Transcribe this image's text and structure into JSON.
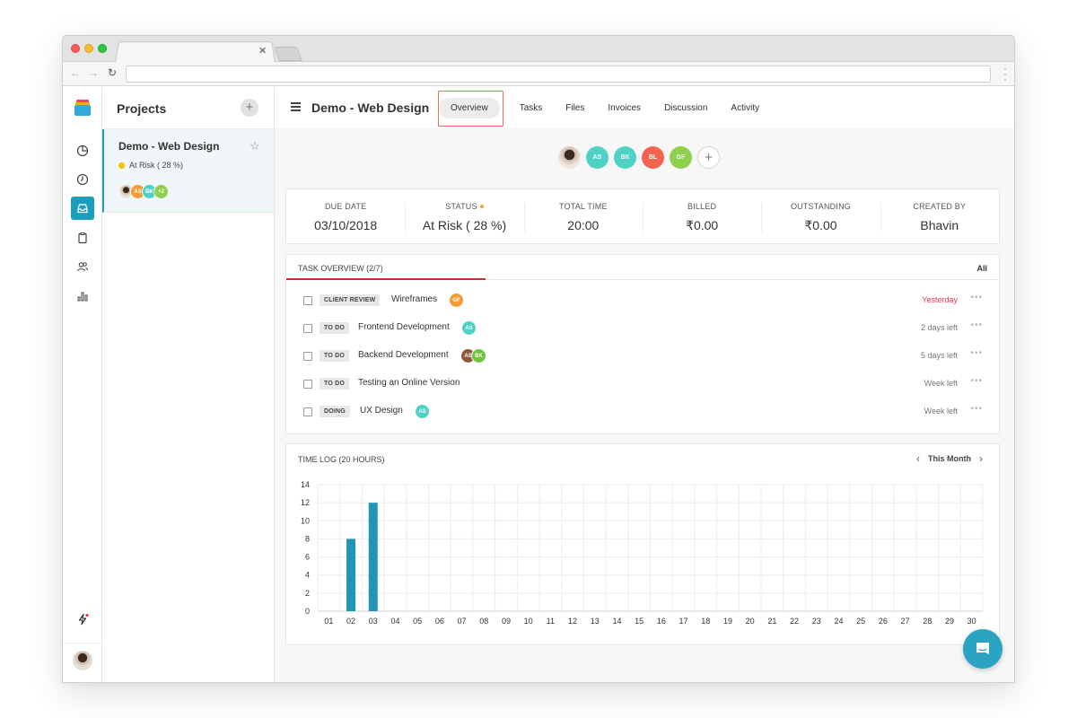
{
  "app": {
    "projects_title": "Projects",
    "project": {
      "name": "Demo - Web Design",
      "status": "At Risk ( 28 %)",
      "avatars": [
        {
          "label": "",
          "photo": true
        },
        {
          "label": "AS",
          "color": "#f39c33"
        },
        {
          "label": "BK",
          "color": "#4fd1c5"
        },
        {
          "label": "+2",
          "color": "#8fd14f"
        }
      ]
    },
    "rail_icons": [
      "logo-icon",
      "pie-chart-icon",
      "clock-icon",
      "inbox-icon",
      "clipboard-icon",
      "users-icon",
      "bar-chart-icon",
      "lightning-icon"
    ]
  },
  "header": {
    "title": "Demo - Web Design",
    "tabs": [
      "Overview",
      "Tasks",
      "Files",
      "Invoices",
      "Discussion",
      "Activity"
    ],
    "active_tab": "Overview"
  },
  "members": [
    {
      "label": "",
      "photo": true
    },
    {
      "label": "AS",
      "color": "#4fd1c5"
    },
    {
      "label": "BK",
      "color": "#4fd1c5"
    },
    {
      "label": "BL",
      "color": "#f2644e"
    },
    {
      "label": "GF",
      "color": "#8fd14f"
    }
  ],
  "stats": [
    {
      "label": "DUE DATE",
      "value": "03/10/2018"
    },
    {
      "label": "STATUS",
      "value": "At Risk ( 28 %)",
      "indicator": "#f5a623"
    },
    {
      "label": "TOTAL TIME",
      "value": "20:00"
    },
    {
      "label": "BILLED",
      "value": "₹0.00"
    },
    {
      "label": "OUTSTANDING",
      "value": "₹0.00"
    },
    {
      "label": "CREATED BY",
      "value": "Bhavin"
    }
  ],
  "task_overview": {
    "title": "TASK OVERVIEW (2/7)",
    "filter": "All",
    "tasks": [
      {
        "tag": "CLIENT REVIEW",
        "name": "Wireframes",
        "assignees": [
          {
            "label": "GF",
            "color": "#f39c33"
          }
        ],
        "due": "Yesterday",
        "overdue": true
      },
      {
        "tag": "TO DO",
        "name": "Frontend Development",
        "assignees": [
          {
            "label": "AS",
            "color": "#4fd1c5"
          }
        ],
        "due": "2 days left",
        "overdue": false
      },
      {
        "tag": "TO DO",
        "name": "Backend Development",
        "assignees": [
          {
            "label": "AS",
            "color": "#8b5a3c"
          },
          {
            "label": "BK",
            "color": "#6fc43a"
          }
        ],
        "due": "5 days left",
        "overdue": false
      },
      {
        "tag": "TO DO",
        "name": "Testing an Online Version",
        "assignees": [],
        "due": "Week left",
        "overdue": false
      },
      {
        "tag": "DOING",
        "name": "UX Design",
        "assignees": [
          {
            "label": "AS",
            "color": "#4fd1c5"
          }
        ],
        "due": "Week left",
        "overdue": false
      }
    ]
  },
  "time_log": {
    "title": "TIME LOG (20 HOURS)",
    "period": "This Month"
  },
  "chart_data": {
    "type": "bar",
    "categories": [
      "01",
      "02",
      "03",
      "04",
      "05",
      "06",
      "07",
      "08",
      "09",
      "10",
      "11",
      "12",
      "13",
      "14",
      "15",
      "16",
      "17",
      "18",
      "19",
      "20",
      "21",
      "22",
      "23",
      "24",
      "25",
      "26",
      "27",
      "28",
      "29",
      "30"
    ],
    "values": [
      0,
      8,
      12,
      0,
      0,
      0,
      0,
      0,
      0,
      0,
      0,
      0,
      0,
      0,
      0,
      0,
      0,
      0,
      0,
      0,
      0,
      0,
      0,
      0,
      0,
      0,
      0,
      0,
      0,
      0
    ],
    "y_ticks": [
      0,
      2,
      4,
      6,
      8,
      10,
      12,
      14
    ],
    "ylim": [
      0,
      14
    ],
    "grid": true,
    "color": "#2196b3"
  }
}
